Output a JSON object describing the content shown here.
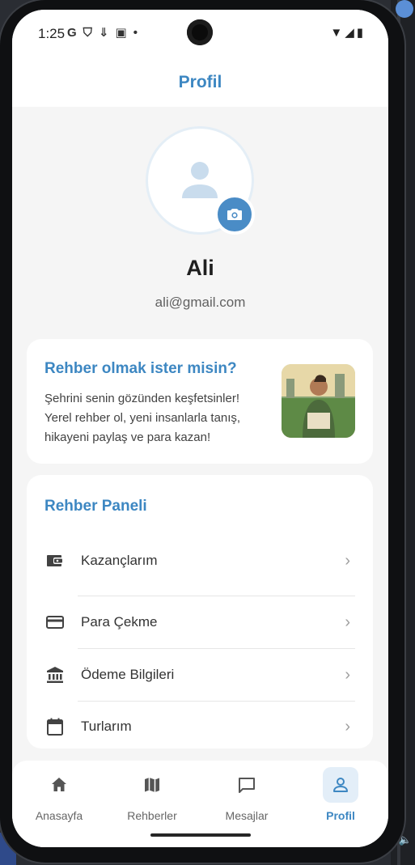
{
  "status_bar": {
    "time": "1:25",
    "left_icons": [
      "google-icon",
      "shield-icon",
      "download-icon",
      "app-icon",
      "dot-icon"
    ],
    "right_icons": [
      "wifi-icon",
      "signal-icon",
      "battery-icon"
    ]
  },
  "app_bar": {
    "title": "Profil"
  },
  "profile": {
    "name": "Ali",
    "email": "ali@gmail.com"
  },
  "promo": {
    "title": "Rehber olmak ister misin?",
    "text": "Şehrini senin gözünden keşfetsinler! Yerel rehber ol, yeni insanlarla tanış, hikayeni paylaş ve para kazan!"
  },
  "panel": {
    "title": "Rehber Paneli",
    "items": [
      {
        "label": "Kazançlarım",
        "icon": "wallet-icon"
      },
      {
        "label": "Para Çekme",
        "icon": "credit-card-icon"
      },
      {
        "label": "Ödeme Bilgileri",
        "icon": "bank-icon"
      },
      {
        "label": "Turlarım",
        "icon": "calendar-icon"
      }
    ]
  },
  "bottom_nav": {
    "items": [
      {
        "label": "Anasayfa",
        "icon": "home-icon",
        "active": false
      },
      {
        "label": "Rehberler",
        "icon": "map-icon",
        "active": false
      },
      {
        "label": "Mesajlar",
        "icon": "chat-icon",
        "active": false
      },
      {
        "label": "Profil",
        "icon": "person-icon",
        "active": true
      }
    ]
  },
  "colors": {
    "accent": "#3d87c2",
    "camera_button": "#4a8cc6",
    "background": "#f5f5f5",
    "card": "#ffffff",
    "active_nav_bg": "#e3eef8"
  }
}
